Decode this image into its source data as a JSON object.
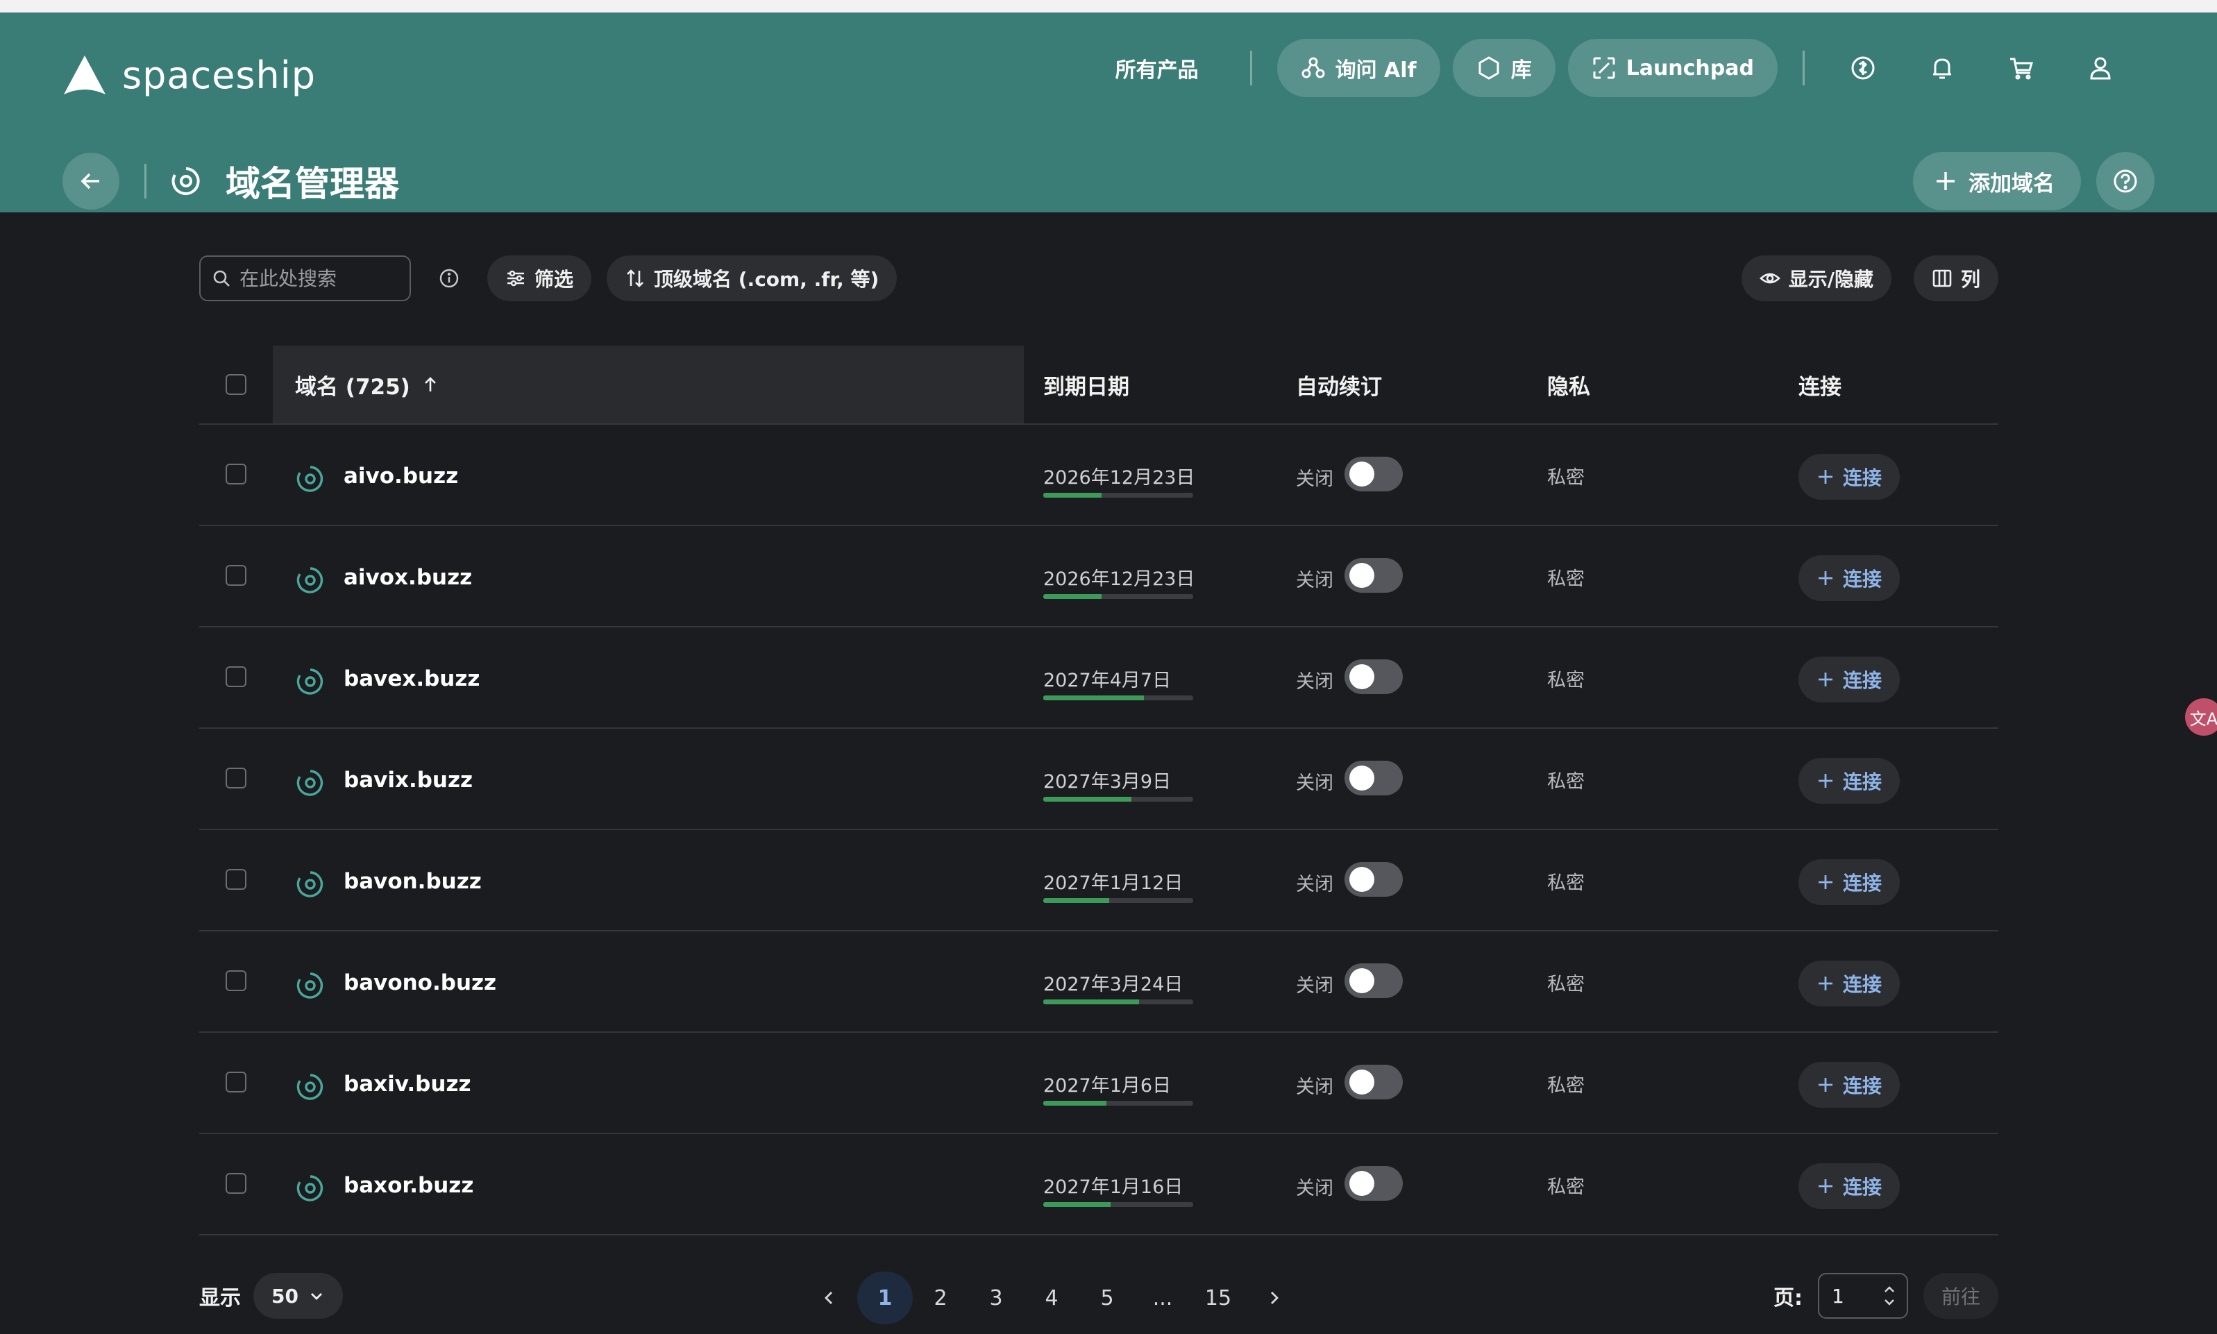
{
  "brand": {
    "name": "spaceship"
  },
  "nav": {
    "all_products": "所有产品",
    "ask_alf": "询问 Alf",
    "library": "库",
    "launchpad": "Launchpad",
    "icons": [
      "billing-icon",
      "bell-icon",
      "cart-icon",
      "user-icon"
    ]
  },
  "page": {
    "title": "域名管理器",
    "add_domain": "添加域名"
  },
  "toolbar": {
    "search_placeholder": "在此处搜索",
    "filter": "筛选",
    "tld_sort": "顶级域名 (.com, .fr, 等)",
    "show_hide": "显示/隐藏",
    "columns": "列"
  },
  "table": {
    "headers": {
      "domain": "域名 (725)",
      "expiry": "到期日期",
      "auto_renew": "自动续订",
      "privacy": "隐私",
      "connect": "连接"
    },
    "rows": [
      {
        "domain": "aivo.buzz",
        "expiry": "2026年12月23日",
        "expiry_progress": 0.39,
        "auto_renew_label": "关闭",
        "auto_renew_on": false,
        "privacy": "私密",
        "connect": "连接"
      },
      {
        "domain": "aivox.buzz",
        "expiry": "2026年12月23日",
        "expiry_progress": 0.39,
        "auto_renew_label": "关闭",
        "auto_renew_on": false,
        "privacy": "私密",
        "connect": "连接"
      },
      {
        "domain": "bavex.buzz",
        "expiry": "2027年4月7日",
        "expiry_progress": 0.67,
        "auto_renew_label": "关闭",
        "auto_renew_on": false,
        "privacy": "私密",
        "connect": "连接"
      },
      {
        "domain": "bavix.buzz",
        "expiry": "2027年3月9日",
        "expiry_progress": 0.59,
        "auto_renew_label": "关闭",
        "auto_renew_on": false,
        "privacy": "私密",
        "connect": "连接"
      },
      {
        "domain": "bavon.buzz",
        "expiry": "2027年1月12日",
        "expiry_progress": 0.44,
        "auto_renew_label": "关闭",
        "auto_renew_on": false,
        "privacy": "私密",
        "connect": "连接"
      },
      {
        "domain": "bavono.buzz",
        "expiry": "2027年3月24日",
        "expiry_progress": 0.64,
        "auto_renew_label": "关闭",
        "auto_renew_on": false,
        "privacy": "私密",
        "connect": "连接"
      },
      {
        "domain": "baxiv.buzz",
        "expiry": "2027年1月6日",
        "expiry_progress": 0.42,
        "auto_renew_label": "关闭",
        "auto_renew_on": false,
        "privacy": "私密",
        "connect": "连接"
      },
      {
        "domain": "baxor.buzz",
        "expiry": "2027年1月16日",
        "expiry_progress": 0.45,
        "auto_renew_label": "关闭",
        "auto_renew_on": false,
        "privacy": "私密",
        "connect": "连接"
      }
    ]
  },
  "footer": {
    "show_label": "显示",
    "per_page": "50",
    "pages": [
      "1",
      "2",
      "3",
      "4",
      "5",
      "...",
      "15"
    ],
    "current_page": "1",
    "page_label": "页:",
    "page_input": "1",
    "go": "前往"
  },
  "colors": {
    "header": "#3a7d76",
    "background": "#1b1c1f",
    "accent": "#8fb4e8",
    "progress": "#3e9a5a"
  }
}
